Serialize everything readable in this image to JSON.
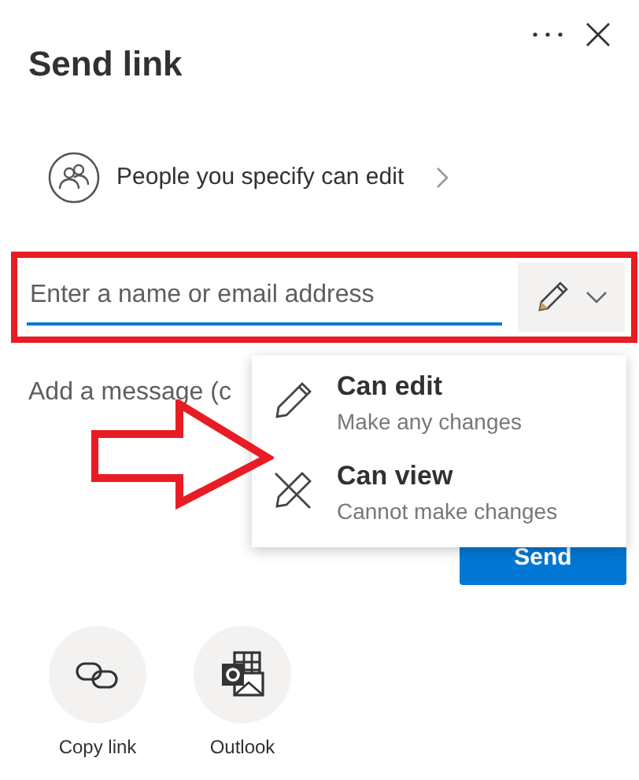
{
  "panel": {
    "title": "Send link"
  },
  "link_setting": {
    "label": "People you specify can edit"
  },
  "recipient_field": {
    "placeholder": "Enter a name or email address"
  },
  "message_field": {
    "placeholder": "Add a message (c"
  },
  "permission_menu": {
    "items": [
      {
        "kind": "edit",
        "title": "Can edit",
        "subtitle": "Make any changes"
      },
      {
        "kind": "view",
        "title": "Can view",
        "subtitle": "Cannot make changes"
      }
    ]
  },
  "send_button": {
    "label": "Send"
  },
  "share_options": [
    {
      "kind": "copy",
      "label": "Copy link"
    },
    {
      "kind": "outlook",
      "label": "Outlook"
    }
  ]
}
